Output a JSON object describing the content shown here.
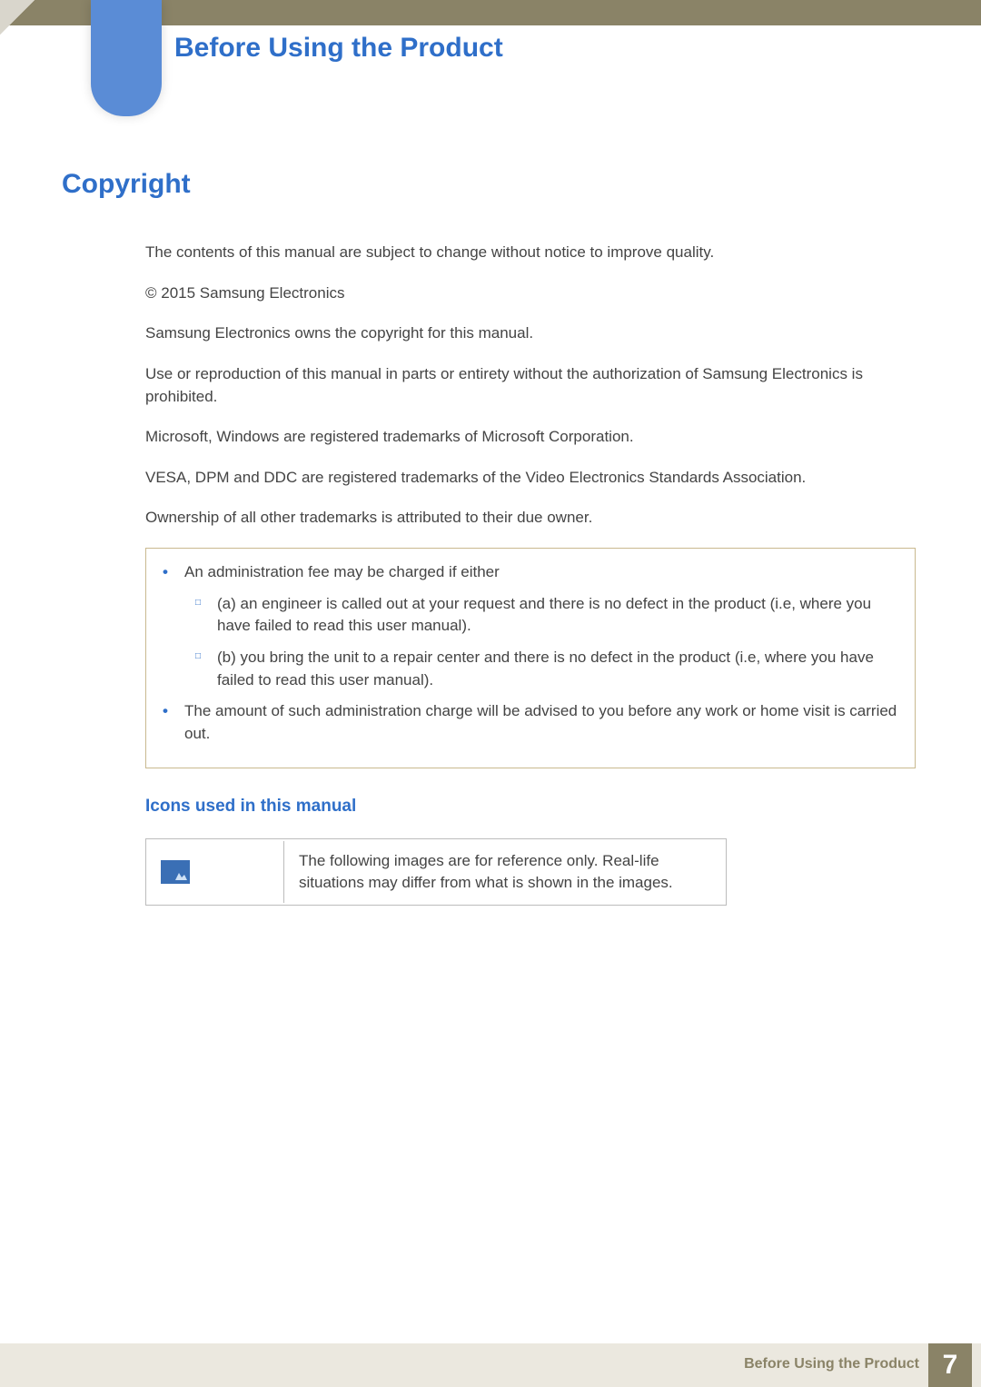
{
  "chapter_title": "Before Using the Product",
  "section_title": "Copyright",
  "paragraphs": {
    "p1": "The contents of this manual are subject to change without notice to improve quality.",
    "p2": "© 2015 Samsung Electronics",
    "p3": "Samsung Electronics owns the copyright for this manual.",
    "p4": "Use or reproduction of this manual in parts or entirety without the authorization of Samsung Electronics is prohibited.",
    "p5": "Microsoft, Windows are registered trademarks of Microsoft Corporation.",
    "p6": "VESA, DPM and DDC are registered trademarks of the Video Electronics Standards Association.",
    "p7": "Ownership of all other trademarks is attributed to their due owner."
  },
  "box": {
    "b1": "An administration fee may be charged if either",
    "b1a": "(a) an engineer is called out at your request and there is no defect in the product (i.e, where you have failed to read this user manual).",
    "b1b": "(b) you bring the unit to a repair center and there is no defect in the product (i.e, where you have failed to read this user manual).",
    "b2": "The amount of such administration charge will be advised to you before any work or home visit is carried out."
  },
  "subsection_title": "Icons used in this manual",
  "icon_table": {
    "desc": "The following images are for reference only. Real-life situations may differ from what is shown in the images."
  },
  "footer": {
    "label": "Before Using the Product",
    "page": "7"
  }
}
